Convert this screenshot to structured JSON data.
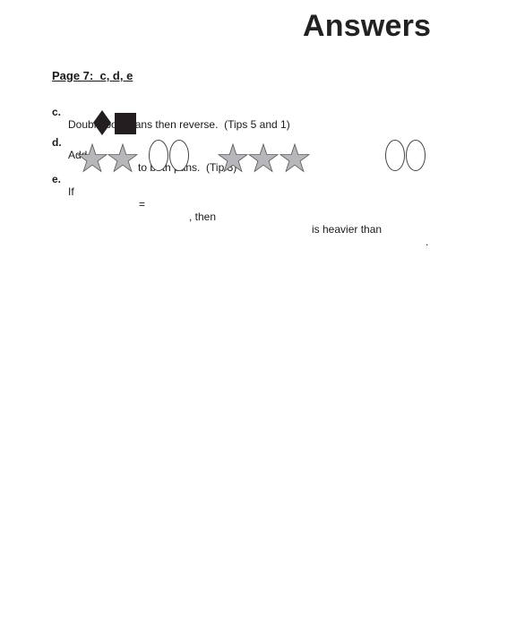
{
  "title": "Answers",
  "section": {
    "heading": "Page 7:  c, d, e"
  },
  "items": {
    "c": {
      "letter": "c.",
      "text": "Double both pans then reverse.  (Tips 5 and 1)"
    },
    "d": {
      "letter": "d.",
      "text_before": "Add",
      "text_after": "to both pans.  (Tip 3)",
      "shapes": [
        "diamond",
        "square"
      ]
    },
    "e": {
      "letter": "e.",
      "text_if": "If",
      "text_equals": "=",
      "text_then": ", then",
      "text_heavier": "is heavier than",
      "text_end": ".",
      "shapes_left": [
        "star",
        "star"
      ],
      "shapes_equal": [
        "oval",
        "oval"
      ],
      "shapes_then": [
        "star",
        "star",
        "star"
      ],
      "shapes_end": [
        "oval",
        "oval"
      ]
    }
  },
  "colors": {
    "star_fill": "#b7b7bb",
    "dark_shape": "#231f20"
  }
}
